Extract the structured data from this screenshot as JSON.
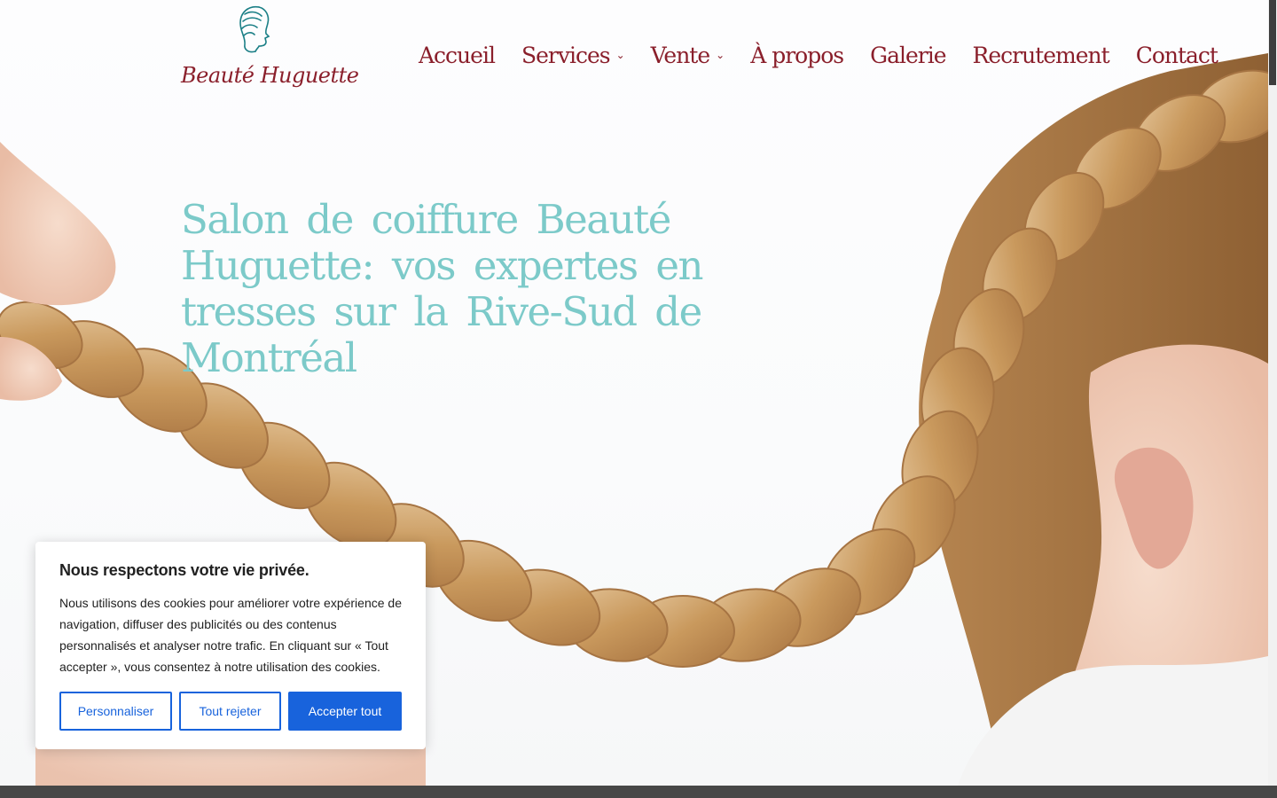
{
  "brand": {
    "name": "Beauté Huguette",
    "logo_icon": "woman-profile-icon",
    "text_color": "#8a1f2b",
    "accent_color": "#7ccac9",
    "logo_color": "#1b7f86"
  },
  "nav": {
    "items": [
      {
        "label": "Accueil",
        "has_dropdown": false
      },
      {
        "label": "Services",
        "has_dropdown": true
      },
      {
        "label": "Vente",
        "has_dropdown": true
      },
      {
        "label": "À propos",
        "has_dropdown": false
      },
      {
        "label": "Galerie",
        "has_dropdown": false
      },
      {
        "label": "Recrutement",
        "has_dropdown": false
      },
      {
        "label": "Contact",
        "has_dropdown": false
      }
    ],
    "dropdown_icon": "chevron-down-icon"
  },
  "hero": {
    "title": "Salon de coiffure Beauté Huguette: vos expertes en tresses sur la Rive-Sud de Montréal"
  },
  "cookie": {
    "title": "Nous respectons votre vie privée.",
    "text": "Nous utilisons des cookies pour améliorer votre expérience de navigation, diffuser des publicités ou des contenus personnalisés et analyser notre trafic. En cliquant sur « Tout accepter », vous consentez à notre utilisation des cookies.",
    "customize_label": "Personnaliser",
    "reject_label": "Tout rejeter",
    "accept_label": "Accepter tout",
    "button_color": "#1863dc"
  }
}
